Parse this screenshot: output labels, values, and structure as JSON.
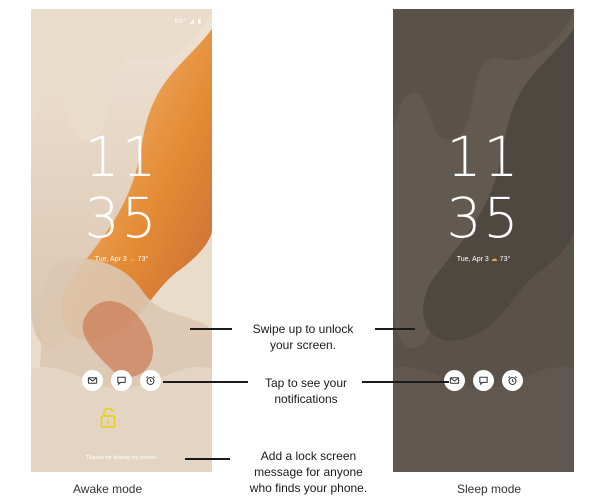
{
  "awake": {
    "status_text": "88°",
    "clock_hour": "11",
    "clock_minute": "35",
    "date": "Tue, Apr 3",
    "temp": "73°",
    "lock_message": "Thanks for finding my phone!",
    "caption": "Awake mode",
    "notifications": [
      "mail-icon",
      "chat-icon",
      "alarm-icon"
    ]
  },
  "sleep": {
    "clock_hour": "11",
    "clock_minute": "35",
    "date": "Tue, Apr 3",
    "temp": "73°",
    "caption": "Sleep mode",
    "notifications": [
      "mail-icon",
      "chat-icon",
      "alarm-icon"
    ]
  },
  "callouts": {
    "swipe_line1": "Swipe up to unlock",
    "swipe_line2": "your screen.",
    "tap_line1": "Tap to see your",
    "tap_line2": "notifications",
    "msg_line1": "Add a lock screen",
    "msg_line2": "message for anyone",
    "msg_line3": "who finds your phone."
  },
  "colors": {
    "lock_icon": "#e6d21a",
    "wallpaper_orange": "#e0852f",
    "sleep_background": "#5a5249"
  }
}
